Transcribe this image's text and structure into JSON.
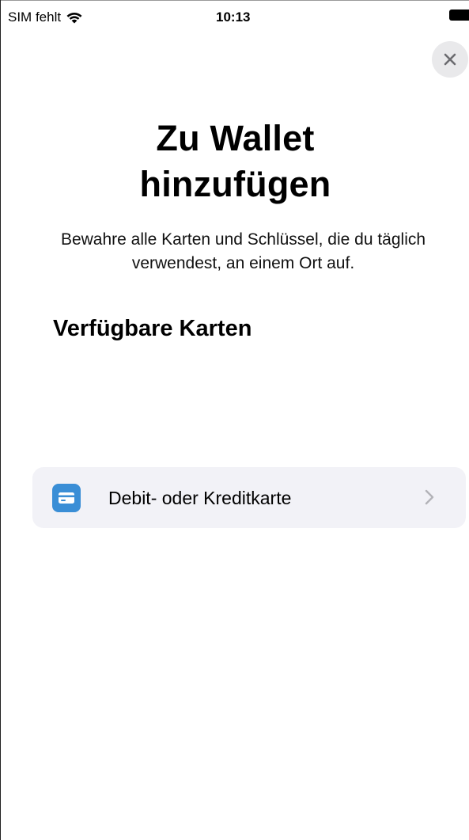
{
  "status_bar": {
    "carrier": "SIM fehlt",
    "time": "10:13",
    "icons": [
      "wifi-icon",
      "battery-icon"
    ]
  },
  "close_button": {
    "icon": "close-icon"
  },
  "header": {
    "title_line1": "Zu Wallet",
    "title_line2": "hinzufügen",
    "subtitle": "Bewahre alle Karten und Schlüssel, die du täglich verwendest, an einem Ort auf."
  },
  "section": {
    "heading": "Verfügbare Karten",
    "items": [
      {
        "label": "Debit- oder Kreditkarte",
        "icon": "credit-card-icon",
        "trailing_icon": "chevron-right-icon"
      }
    ]
  },
  "colors": {
    "card_icon_bg": "#3a8ed6",
    "row_bg": "#f2f2f7",
    "close_bg": "#e9e9eb"
  }
}
